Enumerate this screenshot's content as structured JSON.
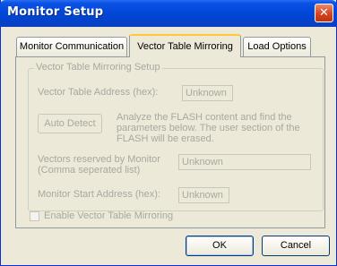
{
  "window": {
    "title": "Monitor Setup",
    "close_glyph": "✕"
  },
  "tabs": [
    {
      "label": "Monitor Communication",
      "active": false
    },
    {
      "label": "Vector Table Mirroring",
      "active": true
    },
    {
      "label": "Load Options",
      "active": false
    }
  ],
  "group": {
    "label": "Vector Table Mirroring Setup",
    "vector_table_address_label": "Vector Table Address (hex):",
    "vector_table_address_value": "Unknown",
    "auto_detect_label": "Auto Detect",
    "auto_detect_description": "Analyze the FLASH content and find the parameters below. The user section of the FLASH will be erased.",
    "vectors_reserved_label_line1": "Vectors reserved by Monitor",
    "vectors_reserved_label_line2": "(Comma seperated list)",
    "vectors_reserved_value": "Unknown",
    "monitor_start_label": "Monitor Start Address (hex):",
    "monitor_start_value": "Unknown"
  },
  "enable_mirroring": {
    "label": "Enable Vector Table Mirroring",
    "checked": false
  },
  "buttons": {
    "ok": "OK",
    "cancel": "Cancel"
  }
}
